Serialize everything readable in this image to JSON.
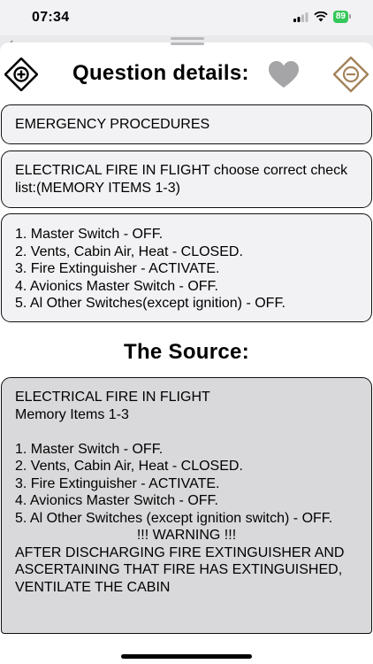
{
  "status_bar": {
    "time": "07:34",
    "battery": "89"
  },
  "header": {
    "title": "Question details:"
  },
  "category": "EMERGENCY PROCEDURES",
  "question": "ELECTRICAL FIRE IN FLIGHT choose correct check list:(MEMORY ITEMS 1-3)",
  "answer": "1. Master Switch - OFF.\n2. Vents, Cabin Air, Heat - CLOSED.\n3. Fire Extinguisher - ACTIVATE.\n4. Avionics Master Switch - OFF.\n5. Al Other Switches(except ignition) - OFF.",
  "source": {
    "title": "The Source:",
    "text_before": "ELECTRICAL FIRE IN FLIGHT\nMemory Items 1-3\n\n1. Master Switch - OFF.\n2. Vents, Cabin Air, Heat - CLOSED.\n3. Fire Extinguisher - ACTIVATE.\n4. Avionics Master Switch - OFF.\n5. Al Other Switches (except ignition switch) - OFF.\n",
    "warning": "!!! WARNING !!!",
    "text_after": "AFTER DISCHARGING FIRE EXTINGUISHER AND ASCERTAINING THAT FIRE HAS EXTINGUISHED, VENTILATE THE CABIN"
  },
  "colors": {
    "accent_brown": "#a4825a",
    "heart_gray": "#a5a5a8",
    "battery_green": "#34c759"
  }
}
